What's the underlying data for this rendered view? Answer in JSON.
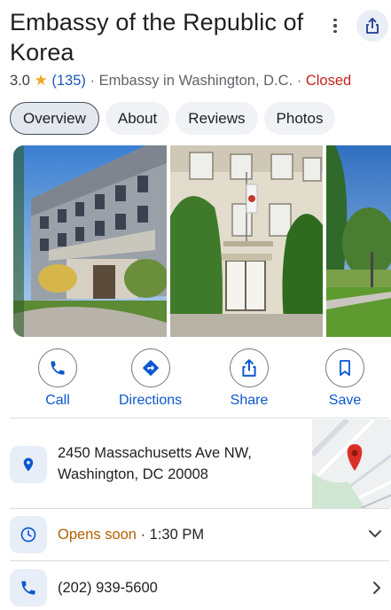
{
  "place": {
    "name": "Embassy of the Republic of Korea",
    "rating": "3.0",
    "star": "★",
    "review_count": "(135)",
    "category": "Embassy in Washington, D.C.",
    "separator": "·",
    "status": "Closed"
  },
  "tabs": [
    {
      "label": "Overview",
      "active": true
    },
    {
      "label": "About"
    },
    {
      "label": "Reviews"
    },
    {
      "label": "Photos"
    }
  ],
  "actions": {
    "call": "Call",
    "directions": "Directions",
    "share": "Share",
    "save": "Save"
  },
  "address": {
    "line1": "2450 Massachusetts Ave NW,",
    "line2": "Washington, DC 20008"
  },
  "hours": {
    "status": "Opens soon",
    "separator": "·",
    "time": "1:30 PM"
  },
  "phone": {
    "number": "(202) 939-5600"
  },
  "icons": {
    "more": "more-vert-icon",
    "share": "share-icon",
    "call": "phone-icon",
    "directions": "directions-icon",
    "save": "bookmark-icon",
    "address": "location-pin-icon",
    "hours": "clock-icon",
    "phone": "phone-icon",
    "expand": "chevron-down-icon",
    "open": "chevron-right-icon"
  },
  "colors": {
    "accent": "#0b57d0",
    "closed": "#c5221f",
    "opens_soon": "#b06000",
    "star": "#f5a623"
  }
}
